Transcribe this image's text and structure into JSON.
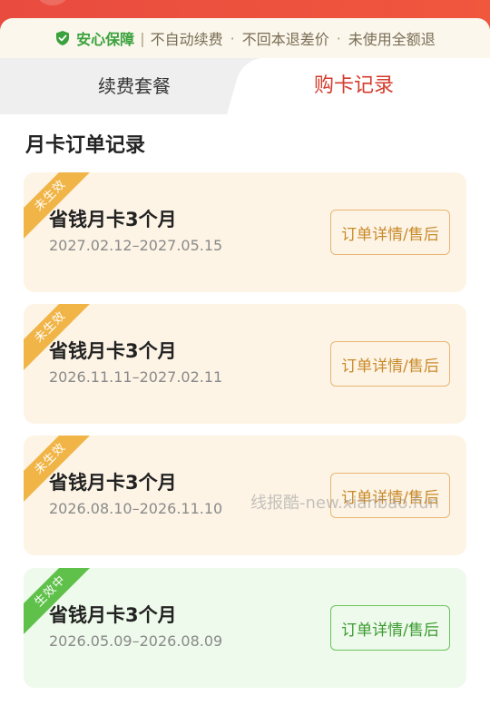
{
  "guarantee": {
    "title": "安心保障",
    "divider": "|",
    "items": [
      "不自动续费",
      "不回本退差价",
      "未使用全额退"
    ],
    "dot": "·"
  },
  "tabs": [
    {
      "label": "续费套餐",
      "selected": false
    },
    {
      "label": "购卡记录",
      "selected": true
    }
  ],
  "section_title": "月卡订单记录",
  "orders": [
    {
      "status": "未生效",
      "name": "省钱月卡3个月",
      "date": "2027.02.12–2027.05.15",
      "action": "订单详情/售后"
    },
    {
      "status": "未生效",
      "name": "省钱月卡3个月",
      "date": "2026.11.11–2027.02.11",
      "action": "订单详情/售后"
    },
    {
      "status": "未生效",
      "name": "省钱月卡3个月",
      "date": "2026.08.10–2026.11.10",
      "action": "订单详情/售后"
    },
    {
      "status": "生效中",
      "name": "省钱月卡3个月",
      "date": "2026.05.09–2026.08.09",
      "action": "订单详情/售后"
    }
  ],
  "watermark": "线报酷-new.xianbao.fun",
  "colors": {
    "accent_red": "#d43b2c",
    "guarantee_green": "#3aa13c",
    "pending_ribbon": "#f1b547",
    "active_ribbon": "#5fc14a"
  }
}
